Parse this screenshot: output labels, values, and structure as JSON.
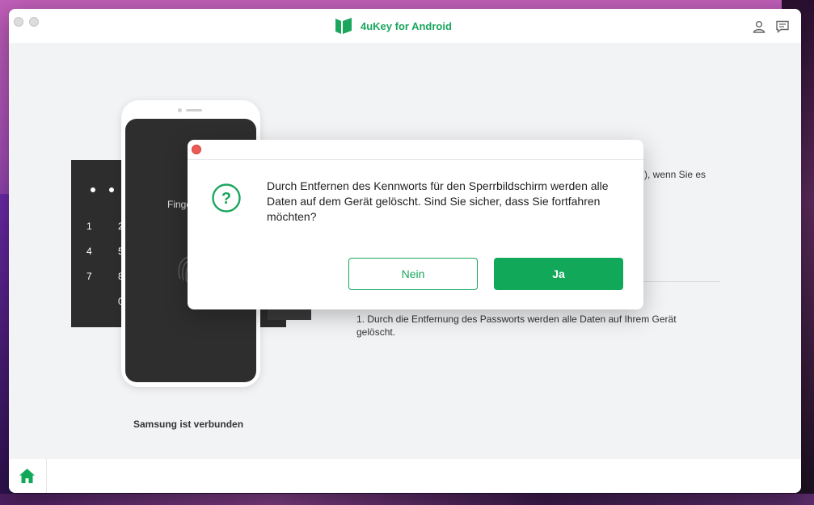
{
  "app": {
    "title": "4uKey for Android",
    "brand_color": "#1aa65d"
  },
  "titlebar": {
    "icons": [
      "account-icon",
      "feedback-icon"
    ]
  },
  "illustration": {
    "keypad_digits": [
      "1",
      "2",
      "4",
      "5",
      "7",
      "8",
      "0"
    ],
    "fingerprint_label": "Finge"
  },
  "device_status": "Samsung ist verbunden",
  "side_text_fragment": "), wenn Sie es",
  "note": "1. Durch die Entfernung des Passworts werden alle Daten auf Ihrem Gerät gelöscht.",
  "dialog": {
    "message": "Durch Entfernen des Kennworts für den Sperrbildschirm werden alle Daten auf dem Gerät gelöscht. Sind Sie sicher, dass Sie fortfahren möchten?",
    "no_label": "Nein",
    "yes_label": "Ja",
    "icon": "question-icon"
  },
  "bottombar": {
    "home_icon": "home-icon"
  }
}
